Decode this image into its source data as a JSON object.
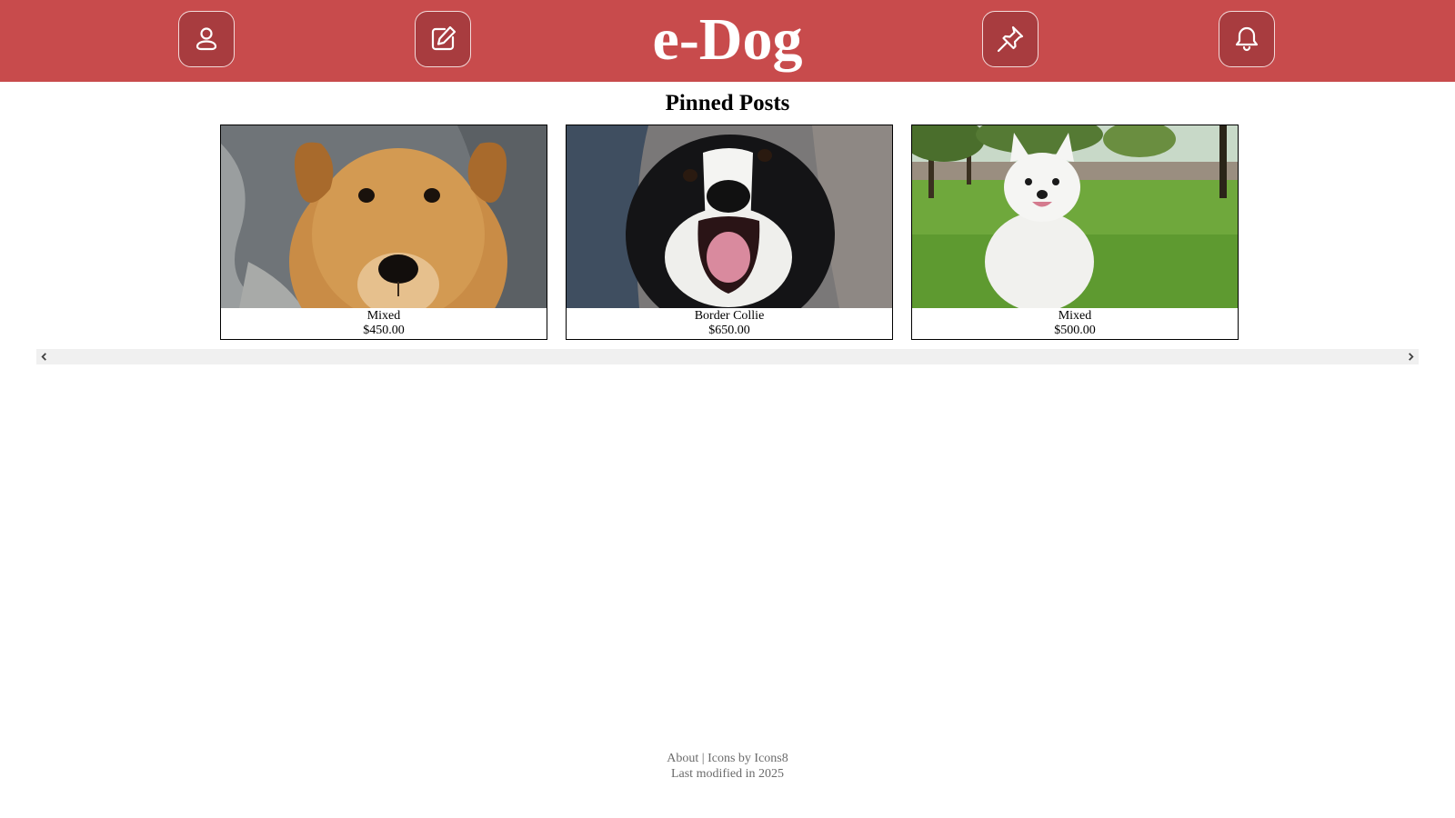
{
  "header": {
    "logo": "e-Dog",
    "background_color": "#c84b4c",
    "buttons": [
      {
        "name": "profile-button",
        "icon": "user-icon"
      },
      {
        "name": "new-post-button",
        "icon": "edit-icon"
      },
      {
        "name": "pinned-button",
        "icon": "pin-icon"
      },
      {
        "name": "notifications-button",
        "icon": "bell-icon"
      }
    ]
  },
  "pinned": {
    "title": "Pinned Posts",
    "posts": [
      {
        "breed": "Mixed",
        "price": "$450.00",
        "photo": "tan-dog-face-photo"
      },
      {
        "breed": "Border Collie",
        "price": "$650.00",
        "photo": "border-collie-photo"
      },
      {
        "breed": "Mixed",
        "price": "$500.00",
        "photo": "white-puppy-on-grass-photo"
      }
    ]
  },
  "scrollbar": {
    "left_icon": "chevron-left-icon",
    "right_icon": "chevron-right-icon"
  },
  "footer": {
    "about_link": "About",
    "separator": "|",
    "icons_credit": "Icons by Icons8",
    "last_modified": "Last modified in 2025"
  }
}
